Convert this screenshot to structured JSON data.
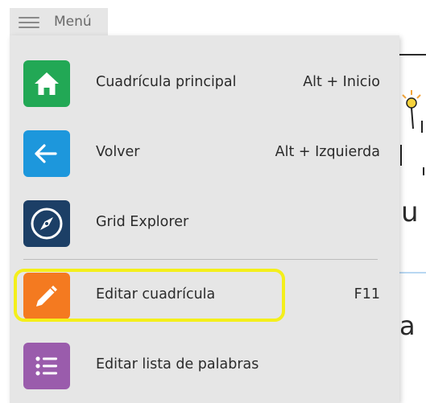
{
  "menu": {
    "trigger_label": "Menú",
    "items": [
      {
        "label": "Cuadrícula principal",
        "shortcut": "Alt + Inicio",
        "icon": "home-icon",
        "color": "#22a855"
      },
      {
        "label": "Volver",
        "shortcut": "Alt + Izquierda",
        "icon": "arrow-left-icon",
        "color": "#1d97dc"
      },
      {
        "label": "Grid Explorer",
        "shortcut": "",
        "icon": "compass-icon",
        "color": "#1c3f66"
      },
      {
        "label": "Editar cuadrícula",
        "shortcut": "F11",
        "icon": "pencil-icon",
        "color": "#f47a20",
        "highlighted": true,
        "highlight_color": "#f4ef1a"
      },
      {
        "label": "Editar lista de palabras",
        "shortcut": "",
        "icon": "list-icon",
        "color": "#9a5cac"
      }
    ]
  },
  "background": {
    "partial_text_1": "u",
    "partial_text_2": "a"
  }
}
